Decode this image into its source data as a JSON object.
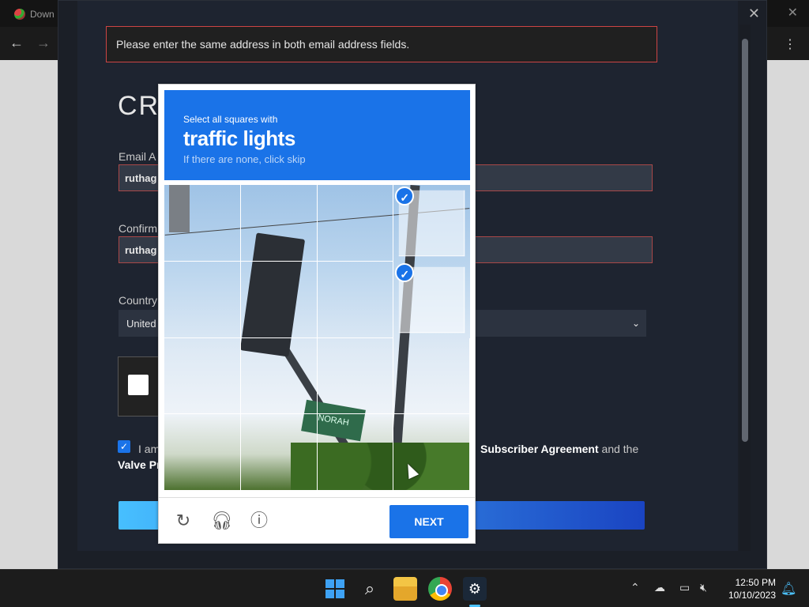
{
  "browser": {
    "tab_title": "Down",
    "back_icon": "←",
    "forward_icon": "→",
    "close_icon": "✕",
    "menu_icon": "⋮"
  },
  "steam": {
    "error_message": "Please enter the same address in both email address fields.",
    "title": "CR",
    "email_label": "Email A",
    "email_value": "ruthag",
    "confirm_label": "Confirm",
    "confirm_value": "ruthag",
    "country_label": "Country",
    "country_value": "United",
    "agree_prefix": "I am",
    "agree_link1": "Subscriber Agreement",
    "agree_mid": "and the",
    "agree_link2": "Valve Pr"
  },
  "recaptcha": {
    "instruction": "Select all squares with",
    "target": "traffic lights",
    "hint": "If there are none, click skip",
    "next_label": "NEXT",
    "sign_text": "NORAH",
    "selected_tiles": [
      3,
      7
    ]
  },
  "taskbar": {
    "time": "12:50 PM",
    "date": "10/10/2023"
  },
  "colors": {
    "accent": "#1a73e8",
    "error_border": "#c44444"
  }
}
